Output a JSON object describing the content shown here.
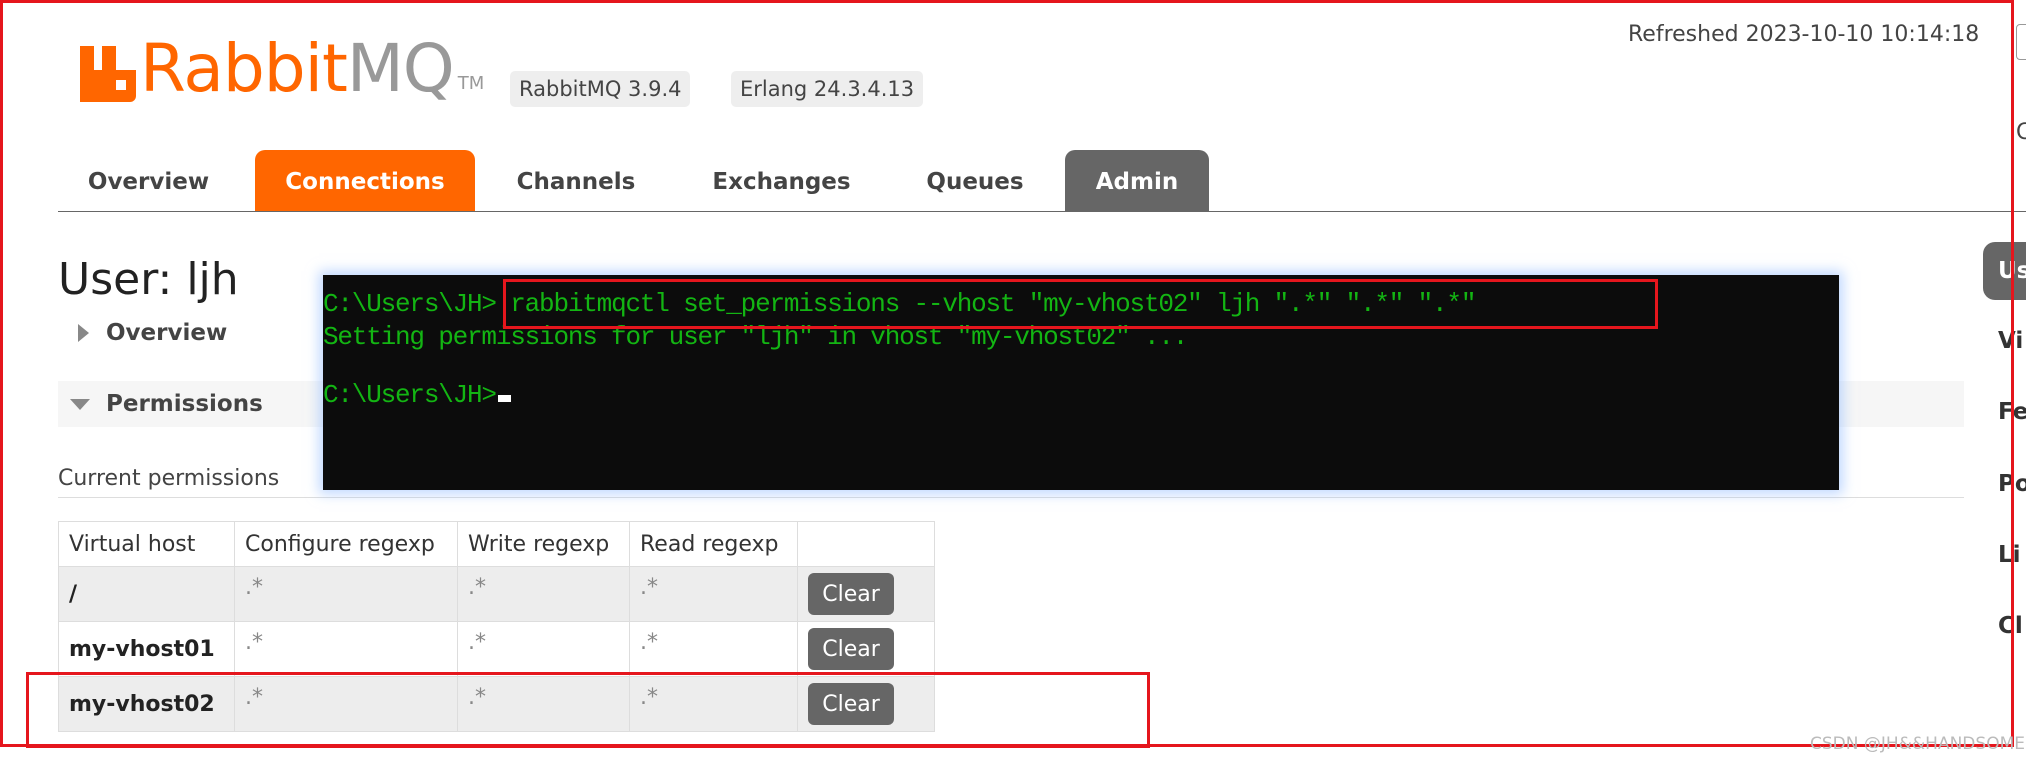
{
  "header": {
    "logo_text": "RabbitMQ",
    "logo_tm": "TM",
    "version_badge": "RabbitMQ 3.9.4",
    "erlang_badge": "Erlang 24.3.4.13",
    "refreshed": "Refreshed 2023-10-10 10:14:18",
    "cut_char": "C"
  },
  "tabs": [
    {
      "label": "Overview"
    },
    {
      "label": "Connections",
      "active": true
    },
    {
      "label": "Channels"
    },
    {
      "label": "Exchanges"
    },
    {
      "label": "Queues"
    },
    {
      "label": "Admin"
    }
  ],
  "page": {
    "title": "User: ljh",
    "overview_toggle": "Overview",
    "permissions_toggle": "Permissions",
    "current_permissions": "Current permissions"
  },
  "table": {
    "headers": [
      "Virtual host",
      "Configure regexp",
      "Write regexp",
      "Read regexp"
    ],
    "rows": [
      {
        "vhost": "/",
        "configure": ".*",
        "write": ".*",
        "read": ".*",
        "action": "Clear"
      },
      {
        "vhost": "my-vhost01",
        "configure": ".*",
        "write": ".*",
        "read": ".*",
        "action": "Clear"
      },
      {
        "vhost": "my-vhost02",
        "configure": ".*",
        "write": ".*",
        "read": ".*",
        "action": "Clear"
      }
    ]
  },
  "terminal": {
    "line1_prompt": "C:\\Users\\JH>",
    "line1_cmd": " rabbitmqctl set_permissions --vhost \"my-vhost02\" ljh \".*\" \".*\" \".*\"",
    "line2": "Setting permissions for user \"ljh\" in vhost \"my-vhost02\" ...",
    "line3_prompt": "C:\\Users\\JH>"
  },
  "sidebar": {
    "items": [
      "Us",
      "Vi",
      "Fe",
      "Po",
      "Li",
      "Cl"
    ]
  },
  "watermark": "CSDN @JH&&HANDSOME",
  "colors": {
    "accent": "#ff6600",
    "admin_tab": "#666666",
    "annotation_red": "#e5161d",
    "terminal_green": "#13b513"
  }
}
